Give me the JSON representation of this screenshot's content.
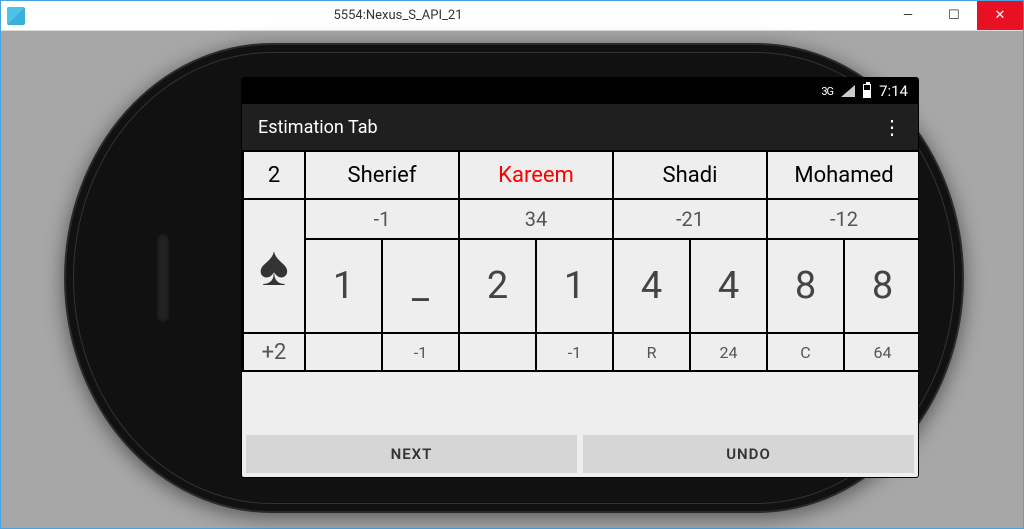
{
  "window": {
    "title": "5554:Nexus_S_API_21"
  },
  "statusbar": {
    "network": "3G",
    "clock": "7:14"
  },
  "actionbar": {
    "title": "Estimation Tab"
  },
  "game": {
    "round": "2",
    "trump_suit": "spade",
    "diff": "+2",
    "players": [
      "Sherief",
      "Kareem",
      "Shadi",
      "Mohamed"
    ],
    "highlight_player_index": 1,
    "totals": [
      "-1",
      "34",
      "-21",
      "-12"
    ],
    "bids": [
      [
        "1",
        "_"
      ],
      [
        "2",
        "1"
      ],
      [
        "4",
        "4"
      ],
      [
        "8",
        "8"
      ]
    ],
    "footer": [
      [
        "",
        "-1"
      ],
      [
        "",
        "-1"
      ],
      [
        "R",
        "24"
      ],
      [
        "C",
        "64"
      ]
    ]
  },
  "buttons": {
    "next": "NEXT",
    "undo": "UNDO"
  },
  "hwkeys": {
    "back": "back",
    "search": "search",
    "recents": "recents",
    "rotate": "rotate"
  }
}
